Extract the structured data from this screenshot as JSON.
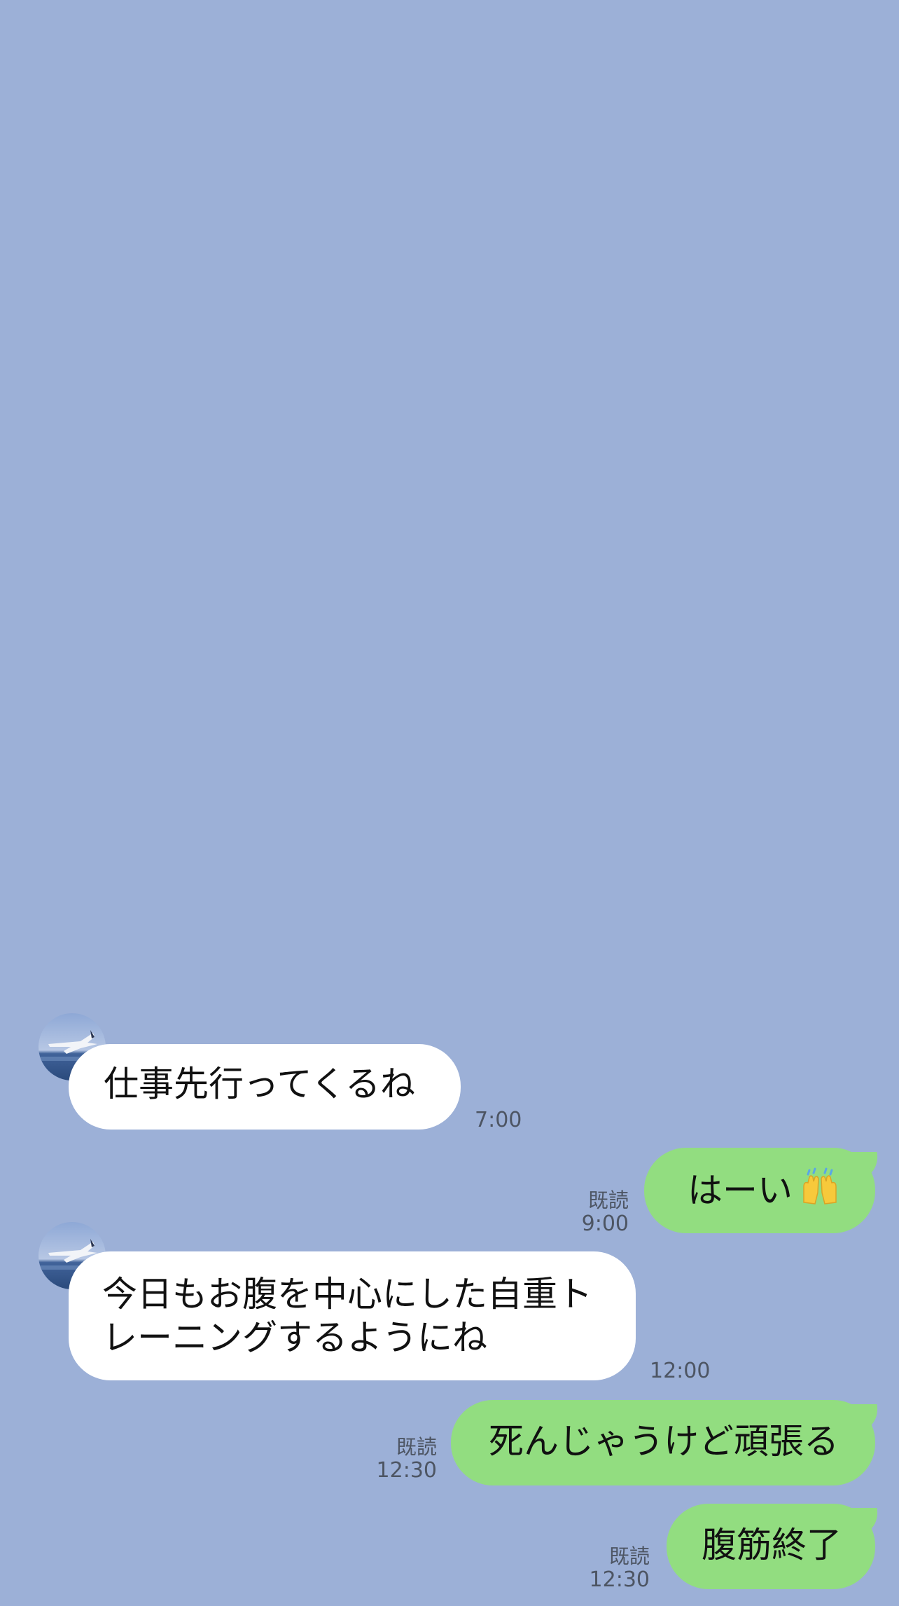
{
  "conversation": {
    "background_color": "#9cb0d7",
    "incoming_bubble_color": "#ffffff",
    "outgoing_bubble_color": "#92dd80",
    "messages": [
      {
        "direction": "incoming",
        "text": "仕事先行ってくるね",
        "time": "7:00",
        "avatar": "airplane-over-sea-avatar"
      },
      {
        "direction": "outgoing",
        "text": "はーい",
        "emoji": "raising-hands-emoji",
        "read": "既読",
        "time": "9:00"
      },
      {
        "direction": "incoming",
        "lines": [
          "今日もお腹を中心にした自重ト",
          "レーニングするようにね"
        ],
        "time": "12:00",
        "avatar": "airplane-over-sea-avatar"
      },
      {
        "direction": "outgoing",
        "text": "死んじゃうけど頑張る",
        "read": "既読",
        "time": "12:30"
      },
      {
        "direction": "outgoing",
        "text": "腹筋終了",
        "read": "既読",
        "time": "12:30"
      }
    ]
  }
}
